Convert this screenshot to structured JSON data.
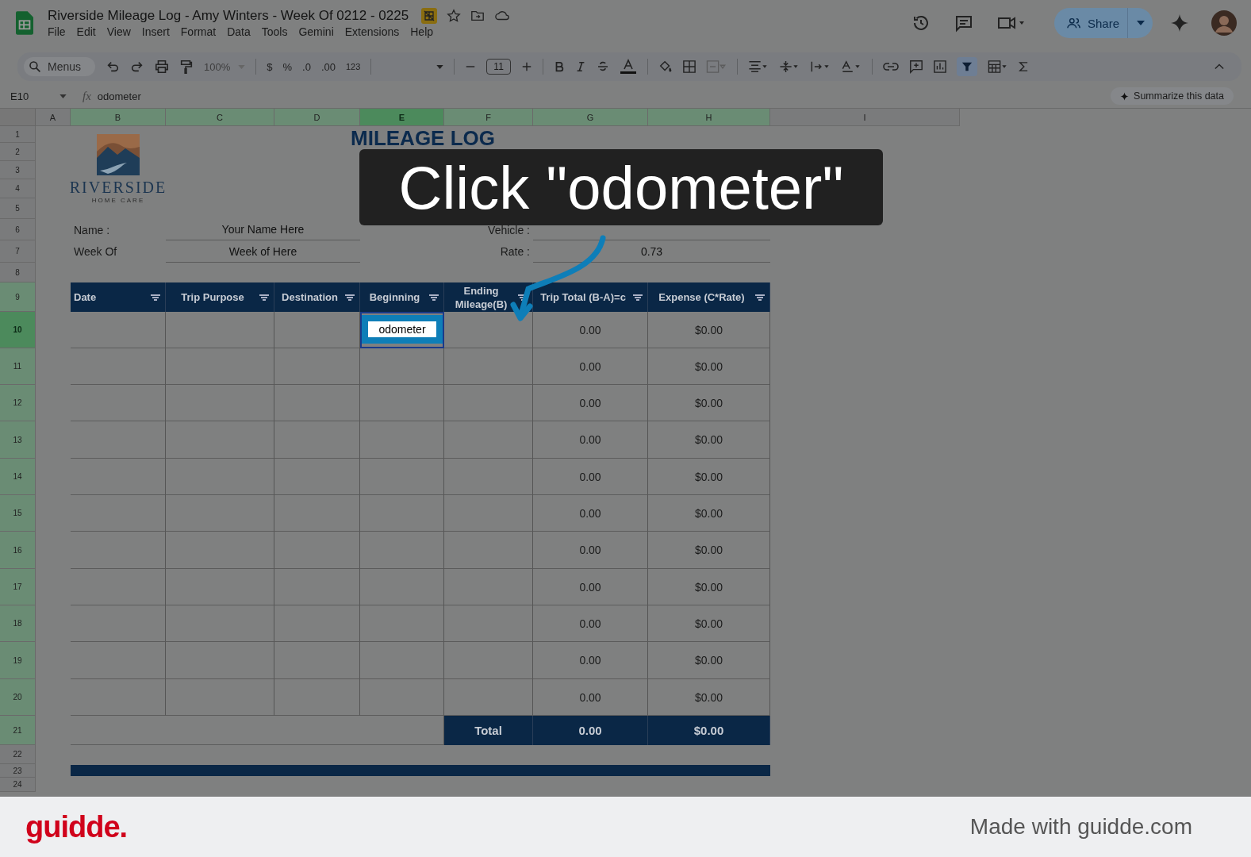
{
  "app": {
    "title": "Riverside Mileage Log - Amy Winters - Week Of 0212 - 0225",
    "menus": [
      "File",
      "Edit",
      "View",
      "Insert",
      "Format",
      "Data",
      "Tools",
      "Gemini",
      "Extensions",
      "Help"
    ],
    "share": "Share"
  },
  "toolbar": {
    "search": "Menus",
    "zoom": "100%",
    "currency": "$",
    "percent": "%",
    "decrease_decimals": ".0",
    "increase_decimals": ".00",
    "number_format": "123",
    "font_size": "11",
    "filter_on": true
  },
  "formula_bar": {
    "cell": "E10",
    "fx": "fx",
    "content": "odometer",
    "summarize": "Summarize this data"
  },
  "columns": [
    {
      "label": "A",
      "selected": false,
      "in_range": false
    },
    {
      "label": "B",
      "selected": false,
      "in_range": true
    },
    {
      "label": "C",
      "selected": false,
      "in_range": true
    },
    {
      "label": "D",
      "selected": false,
      "in_range": true
    },
    {
      "label": "E",
      "selected": true
    },
    {
      "label": "F",
      "selected": false,
      "in_range": true
    },
    {
      "label": "G",
      "selected": false,
      "in_range": true
    },
    {
      "label": "H",
      "selected": false,
      "in_range": true
    },
    {
      "label": "I",
      "selected": false,
      "in_range": false
    }
  ],
  "rows": [
    {
      "label": "1",
      "selected": false,
      "in_range": false
    },
    {
      "label": "2",
      "selected": false,
      "in_range": false
    },
    {
      "label": "3",
      "selected": false,
      "in_range": false
    },
    {
      "label": "4",
      "selected": false,
      "in_range": false
    },
    {
      "label": "5",
      "selected": false,
      "in_range": false
    },
    {
      "label": "6",
      "selected": false,
      "in_range": false
    },
    {
      "label": "7",
      "selected": false,
      "in_range": false
    },
    {
      "label": "8",
      "selected": false,
      "in_range": false
    },
    {
      "label": "9",
      "selected": false,
      "in_range": true
    },
    {
      "label": "10",
      "selected": true
    },
    {
      "label": "11",
      "selected": false,
      "in_range": true
    },
    {
      "label": "12",
      "selected": false,
      "in_range": true
    },
    {
      "label": "13",
      "selected": false,
      "in_range": true
    },
    {
      "label": "14",
      "selected": false,
      "in_range": true
    },
    {
      "label": "15",
      "selected": false,
      "in_range": true
    },
    {
      "label": "16",
      "selected": false,
      "in_range": true
    },
    {
      "label": "17",
      "selected": false,
      "in_range": true
    },
    {
      "label": "18",
      "selected": false,
      "in_range": true
    },
    {
      "label": "19",
      "selected": false,
      "in_range": true
    },
    {
      "label": "20",
      "selected": false,
      "in_range": true
    },
    {
      "label": "21",
      "selected": false,
      "in_range": true
    },
    {
      "label": "22",
      "selected": false,
      "in_range": false
    },
    {
      "label": "23",
      "selected": false,
      "in_range": false
    },
    {
      "label": "24",
      "selected": false,
      "in_range": false
    }
  ],
  "sheet": {
    "logo": {
      "name": "RIVERSIDE",
      "tagline": "HOME CARE"
    },
    "title": "MILEAGE LOG",
    "fields_left": [
      {
        "label": "Name :",
        "value": "Your Name Here"
      },
      {
        "label": "Week Of",
        "value": "Week of Here"
      }
    ],
    "fields_right": [
      {
        "label": "Vehicle :"
      },
      {
        "label": "Rate :",
        "value": "0.73"
      }
    ],
    "headers": [
      "Date",
      "Trip Purpose",
      "Destination",
      "Beginning",
      "Ending Mileage(B)",
      "Trip Total (B-A)=c",
      "Expense (C*Rate)"
    ],
    "data_rows": [
      {
        "trip_total": "0.00",
        "expense": "$0.00"
      },
      {
        "trip_total": "0.00",
        "expense": "$0.00"
      },
      {
        "trip_total": "0.00",
        "expense": "$0.00"
      },
      {
        "trip_total": "0.00",
        "expense": "$0.00"
      },
      {
        "trip_total": "0.00",
        "expense": "$0.00"
      },
      {
        "trip_total": "0.00",
        "expense": "$0.00"
      },
      {
        "trip_total": "0.00",
        "expense": "$0.00"
      },
      {
        "trip_total": "0.00",
        "expense": "$0.00"
      },
      {
        "trip_total": "0.00",
        "expense": "$0.00"
      },
      {
        "trip_total": "0.00",
        "expense": "$0.00"
      },
      {
        "trip_total": "0.00",
        "expense": "$0.00"
      }
    ],
    "total": {
      "label": "Total",
      "trip_total": "0.00",
      "expense": "$0.00"
    },
    "editor": {
      "value": "odometer"
    }
  },
  "callout": "Click \"odometer\"",
  "footer": {
    "brand": "guidde.",
    "credit": "Made with guidde.com"
  }
}
